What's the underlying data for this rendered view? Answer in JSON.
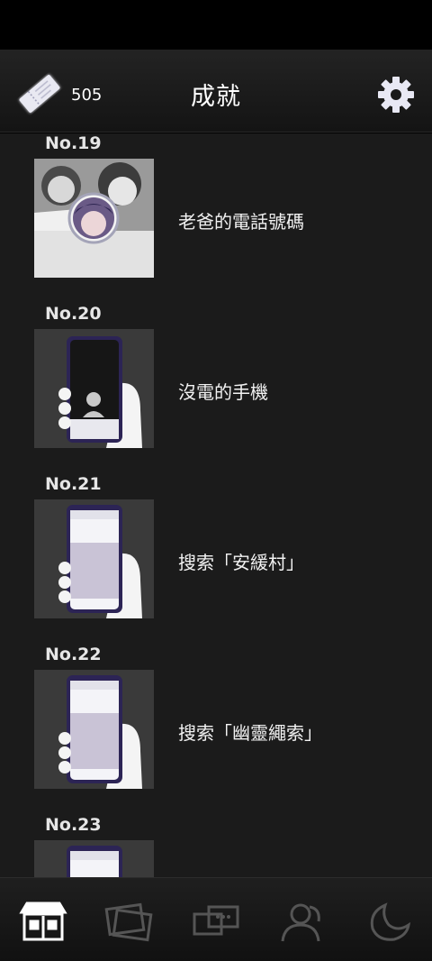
{
  "header": {
    "ticket_count": "505",
    "title": "成就"
  },
  "achievements": [
    {
      "number": "No.19",
      "title": "老爸的電話號碼"
    },
    {
      "number": "No.20",
      "title": "沒電的手機"
    },
    {
      "number": "No.21",
      "title": "搜索「安緩村」"
    },
    {
      "number": "No.22",
      "title": "搜索「幽靈繩索」"
    },
    {
      "number": "No.23",
      "title": ""
    }
  ],
  "tabbar": {
    "tabs": [
      "shop-icon",
      "photos-icon",
      "messages-icon",
      "contacts-icon",
      "moon-icon"
    ],
    "active": "shop-icon"
  }
}
